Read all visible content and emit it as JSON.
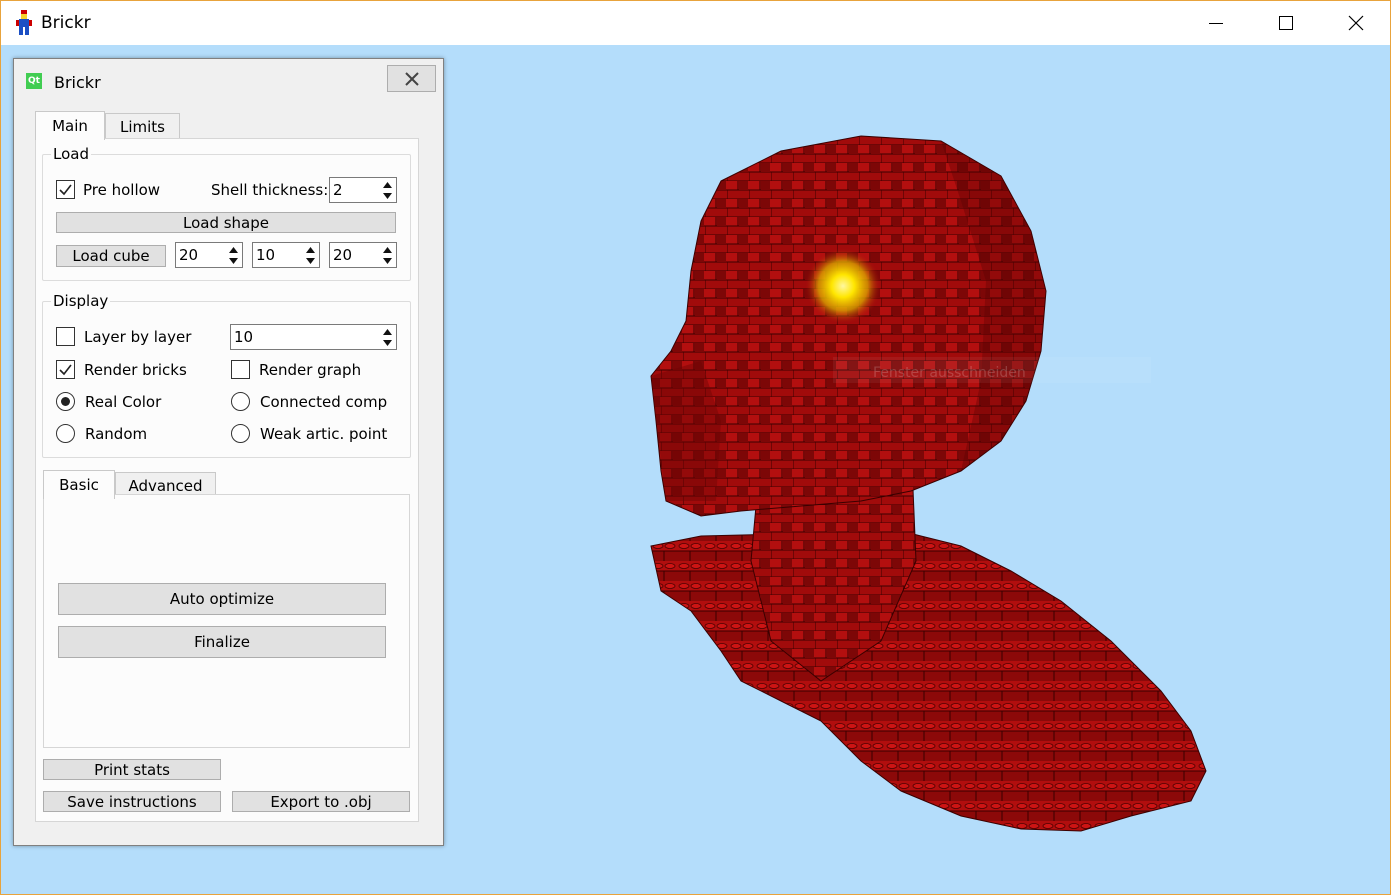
{
  "window": {
    "title": "Brickr"
  },
  "viewport": {
    "background": "#b4ddfb",
    "model_color": "#9a0a0a",
    "watermark": "Fenster ausschneiden"
  },
  "panel": {
    "title": "Brickr",
    "tabs": [
      {
        "label": "Main"
      },
      {
        "label": "Limits"
      }
    ],
    "load": {
      "group_title": "Load",
      "pre_hollow_label": "Pre hollow",
      "pre_hollow_checked": true,
      "shell_label": "Shell thickness:",
      "shell_value": "2",
      "load_shape": "Load shape",
      "load_cube": "Load cube",
      "cube_x": "20",
      "cube_y": "10",
      "cube_z": "20"
    },
    "display": {
      "group_title": "Display",
      "layer_by_layer": "Layer by layer",
      "layer_value": "10",
      "render_bricks": "Render bricks",
      "render_graph": "Render graph",
      "real_color": "Real Color",
      "connected_comp": "Connected comp",
      "random": "Random",
      "weak_artic": "Weak artic. point"
    },
    "subtabs": [
      {
        "label": "Basic"
      },
      {
        "label": "Advanced"
      }
    ],
    "auto_optimize": "Auto optimize",
    "finalize": "Finalize",
    "print_stats": "Print stats",
    "save_instructions": "Save instructions",
    "export_obj": "Export to .obj"
  }
}
